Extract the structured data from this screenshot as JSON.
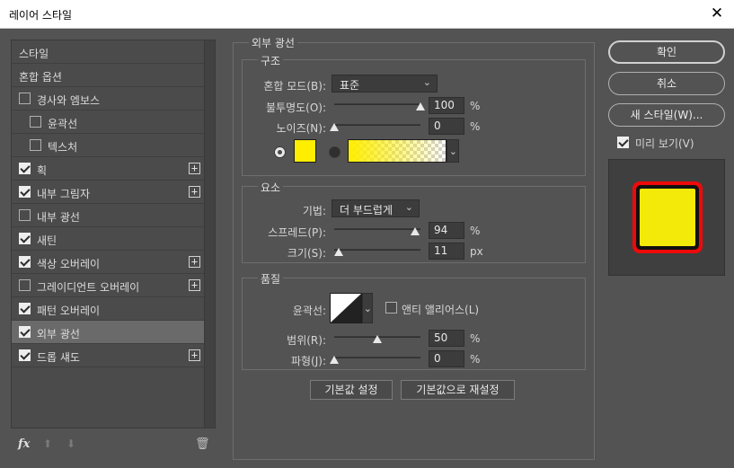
{
  "window": {
    "title": "레이어 스타일",
    "close_glyph": "✕"
  },
  "left_panel": {
    "header": "스타일",
    "blend_options": "혼합 옵션",
    "items": [
      {
        "label": "경사와 엠보스",
        "checked": false,
        "plus": false
      },
      {
        "label": "윤곽선",
        "checked": false,
        "plus": false,
        "sub": true
      },
      {
        "label": "텍스처",
        "checked": false,
        "plus": false,
        "sub": true
      },
      {
        "label": "획",
        "checked": true,
        "plus": true
      },
      {
        "label": "내부 그림자",
        "checked": true,
        "plus": true
      },
      {
        "label": "내부 광선",
        "checked": false,
        "plus": false
      },
      {
        "label": "새틴",
        "checked": true,
        "plus": false
      },
      {
        "label": "색상 오버레이",
        "checked": true,
        "plus": true
      },
      {
        "label": "그레이디언트 오버레이",
        "checked": false,
        "plus": true
      },
      {
        "label": "패턴 오버레이",
        "checked": true,
        "plus": false
      },
      {
        "label": "외부 광선",
        "checked": true,
        "plus": false,
        "selected": true
      },
      {
        "label": "드롭 섀도",
        "checked": true,
        "plus": true
      }
    ],
    "plus_glyph": "+",
    "footer": {
      "fx": "fx",
      "up": "⬆",
      "down": "⬇",
      "trash": "🗑"
    }
  },
  "panel": {
    "title": "외부 광선",
    "structure": {
      "title": "구조",
      "blend_mode_label": "혼합 모드(B):",
      "blend_mode_value": "표준",
      "opacity_label": "불투명도(O):",
      "opacity_value": "100",
      "opacity_fraction": 1.0,
      "noise_label": "노이즈(N):",
      "noise_value": "0",
      "noise_fraction": 0.0,
      "percent": "%",
      "color_swatch": "#ffee00"
    },
    "elements": {
      "title": "요소",
      "technique_label": "기법:",
      "technique_value": "더 부드럽게",
      "spread_label": "스프레드(P):",
      "spread_value": "94",
      "spread_fraction": 0.94,
      "size_label": "크기(S):",
      "size_value": "11",
      "size_fraction": 0.05,
      "percent": "%",
      "px": "px"
    },
    "quality": {
      "title": "품질",
      "contour_label": "윤곽선:",
      "anti_alias_label": "앤티 앨리어스(L)",
      "range_label": "범위(R):",
      "range_value": "50",
      "range_fraction": 0.5,
      "jitter_label": "파형(J):",
      "jitter_value": "0",
      "jitter_fraction": 0.0,
      "percent": "%"
    },
    "buttons": {
      "make_default": "기본값 설정",
      "reset_default": "기본값으로 재설정"
    }
  },
  "right": {
    "ok": "확인",
    "cancel": "취소",
    "new_style": "새 스타일(W)...",
    "preview_label": "미리 보기(V)",
    "preview_checked": true
  },
  "colors": {
    "glow": "#ffee00",
    "stroke": "#ee0a0a",
    "fill": "#f4ea0a"
  }
}
